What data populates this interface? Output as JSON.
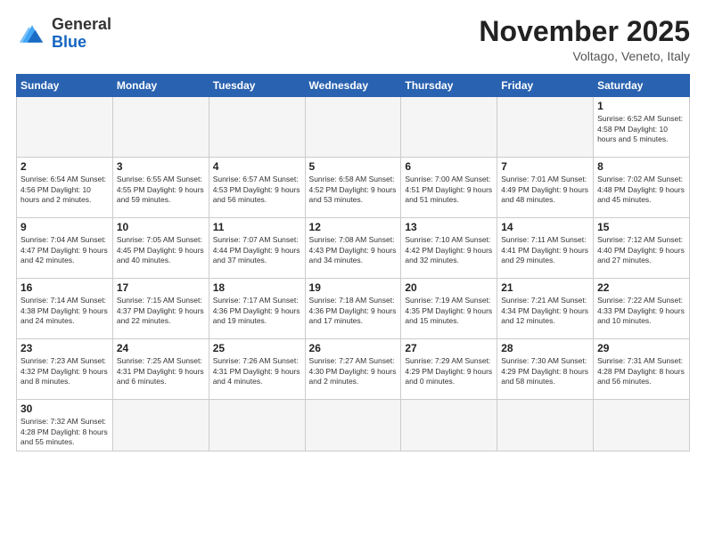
{
  "logo": {
    "text_general": "General",
    "text_blue": "Blue"
  },
  "header": {
    "month": "November 2025",
    "location": "Voltago, Veneto, Italy"
  },
  "days_of_week": [
    "Sunday",
    "Monday",
    "Tuesday",
    "Wednesday",
    "Thursday",
    "Friday",
    "Saturday"
  ],
  "weeks": [
    [
      {
        "day": "",
        "info": ""
      },
      {
        "day": "",
        "info": ""
      },
      {
        "day": "",
        "info": ""
      },
      {
        "day": "",
        "info": ""
      },
      {
        "day": "",
        "info": ""
      },
      {
        "day": "",
        "info": ""
      },
      {
        "day": "1",
        "info": "Sunrise: 6:52 AM\nSunset: 4:58 PM\nDaylight: 10 hours and 5 minutes."
      }
    ],
    [
      {
        "day": "2",
        "info": "Sunrise: 6:54 AM\nSunset: 4:56 PM\nDaylight: 10 hours and 2 minutes."
      },
      {
        "day": "3",
        "info": "Sunrise: 6:55 AM\nSunset: 4:55 PM\nDaylight: 9 hours and 59 minutes."
      },
      {
        "day": "4",
        "info": "Sunrise: 6:57 AM\nSunset: 4:53 PM\nDaylight: 9 hours and 56 minutes."
      },
      {
        "day": "5",
        "info": "Sunrise: 6:58 AM\nSunset: 4:52 PM\nDaylight: 9 hours and 53 minutes."
      },
      {
        "day": "6",
        "info": "Sunrise: 7:00 AM\nSunset: 4:51 PM\nDaylight: 9 hours and 51 minutes."
      },
      {
        "day": "7",
        "info": "Sunrise: 7:01 AM\nSunset: 4:49 PM\nDaylight: 9 hours and 48 minutes."
      },
      {
        "day": "8",
        "info": "Sunrise: 7:02 AM\nSunset: 4:48 PM\nDaylight: 9 hours and 45 minutes."
      }
    ],
    [
      {
        "day": "9",
        "info": "Sunrise: 7:04 AM\nSunset: 4:47 PM\nDaylight: 9 hours and 42 minutes."
      },
      {
        "day": "10",
        "info": "Sunrise: 7:05 AM\nSunset: 4:45 PM\nDaylight: 9 hours and 40 minutes."
      },
      {
        "day": "11",
        "info": "Sunrise: 7:07 AM\nSunset: 4:44 PM\nDaylight: 9 hours and 37 minutes."
      },
      {
        "day": "12",
        "info": "Sunrise: 7:08 AM\nSunset: 4:43 PM\nDaylight: 9 hours and 34 minutes."
      },
      {
        "day": "13",
        "info": "Sunrise: 7:10 AM\nSunset: 4:42 PM\nDaylight: 9 hours and 32 minutes."
      },
      {
        "day": "14",
        "info": "Sunrise: 7:11 AM\nSunset: 4:41 PM\nDaylight: 9 hours and 29 minutes."
      },
      {
        "day": "15",
        "info": "Sunrise: 7:12 AM\nSunset: 4:40 PM\nDaylight: 9 hours and 27 minutes."
      }
    ],
    [
      {
        "day": "16",
        "info": "Sunrise: 7:14 AM\nSunset: 4:38 PM\nDaylight: 9 hours and 24 minutes."
      },
      {
        "day": "17",
        "info": "Sunrise: 7:15 AM\nSunset: 4:37 PM\nDaylight: 9 hours and 22 minutes."
      },
      {
        "day": "18",
        "info": "Sunrise: 7:17 AM\nSunset: 4:36 PM\nDaylight: 9 hours and 19 minutes."
      },
      {
        "day": "19",
        "info": "Sunrise: 7:18 AM\nSunset: 4:36 PM\nDaylight: 9 hours and 17 minutes."
      },
      {
        "day": "20",
        "info": "Sunrise: 7:19 AM\nSunset: 4:35 PM\nDaylight: 9 hours and 15 minutes."
      },
      {
        "day": "21",
        "info": "Sunrise: 7:21 AM\nSunset: 4:34 PM\nDaylight: 9 hours and 12 minutes."
      },
      {
        "day": "22",
        "info": "Sunrise: 7:22 AM\nSunset: 4:33 PM\nDaylight: 9 hours and 10 minutes."
      }
    ],
    [
      {
        "day": "23",
        "info": "Sunrise: 7:23 AM\nSunset: 4:32 PM\nDaylight: 9 hours and 8 minutes."
      },
      {
        "day": "24",
        "info": "Sunrise: 7:25 AM\nSunset: 4:31 PM\nDaylight: 9 hours and 6 minutes."
      },
      {
        "day": "25",
        "info": "Sunrise: 7:26 AM\nSunset: 4:31 PM\nDaylight: 9 hours and 4 minutes."
      },
      {
        "day": "26",
        "info": "Sunrise: 7:27 AM\nSunset: 4:30 PM\nDaylight: 9 hours and 2 minutes."
      },
      {
        "day": "27",
        "info": "Sunrise: 7:29 AM\nSunset: 4:29 PM\nDaylight: 9 hours and 0 minutes."
      },
      {
        "day": "28",
        "info": "Sunrise: 7:30 AM\nSunset: 4:29 PM\nDaylight: 8 hours and 58 minutes."
      },
      {
        "day": "29",
        "info": "Sunrise: 7:31 AM\nSunset: 4:28 PM\nDaylight: 8 hours and 56 minutes."
      }
    ],
    [
      {
        "day": "30",
        "info": "Sunrise: 7:32 AM\nSunset: 4:28 PM\nDaylight: 8 hours and 55 minutes."
      },
      {
        "day": "",
        "info": ""
      },
      {
        "day": "",
        "info": ""
      },
      {
        "day": "",
        "info": ""
      },
      {
        "day": "",
        "info": ""
      },
      {
        "day": "",
        "info": ""
      },
      {
        "day": "",
        "info": ""
      }
    ]
  ]
}
